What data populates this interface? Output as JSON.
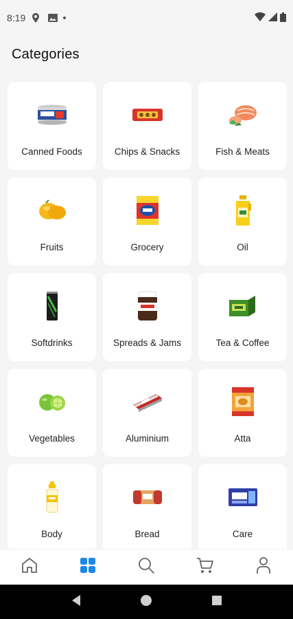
{
  "status": {
    "time": "8:19"
  },
  "page": {
    "title": "Categories"
  },
  "categories": [
    {
      "label": "Canned Foods",
      "icon": "canned-food-icon"
    },
    {
      "label": "Chips & Snacks",
      "icon": "snack-pack-icon"
    },
    {
      "label": "Fish & Meats",
      "icon": "fish-icon"
    },
    {
      "label": "Fruits",
      "icon": "mango-icon"
    },
    {
      "label": "Grocery",
      "icon": "detergent-pack-icon"
    },
    {
      "label": "Oil",
      "icon": "oil-bottle-icon"
    },
    {
      "label": "Softdrinks",
      "icon": "soda-can-icon"
    },
    {
      "label": "Spreads & Jams",
      "icon": "spread-jar-icon"
    },
    {
      "label": "Tea & Coffee",
      "icon": "tea-box-icon"
    },
    {
      "label": "Vegetables",
      "icon": "lime-icon"
    },
    {
      "label": "Aluminium",
      "icon": "foil-roll-icon"
    },
    {
      "label": "Atta",
      "icon": "flour-bag-icon"
    },
    {
      "label": "Body",
      "icon": "lotion-bottle-icon"
    },
    {
      "label": "Bread",
      "icon": "bread-loaf-icon"
    },
    {
      "label": "Care",
      "icon": "care-pack-icon"
    }
  ],
  "bottom_nav": {
    "active": "categories",
    "items": [
      "home",
      "categories",
      "search",
      "cart",
      "profile"
    ],
    "accent_color": "#1e88e5"
  }
}
